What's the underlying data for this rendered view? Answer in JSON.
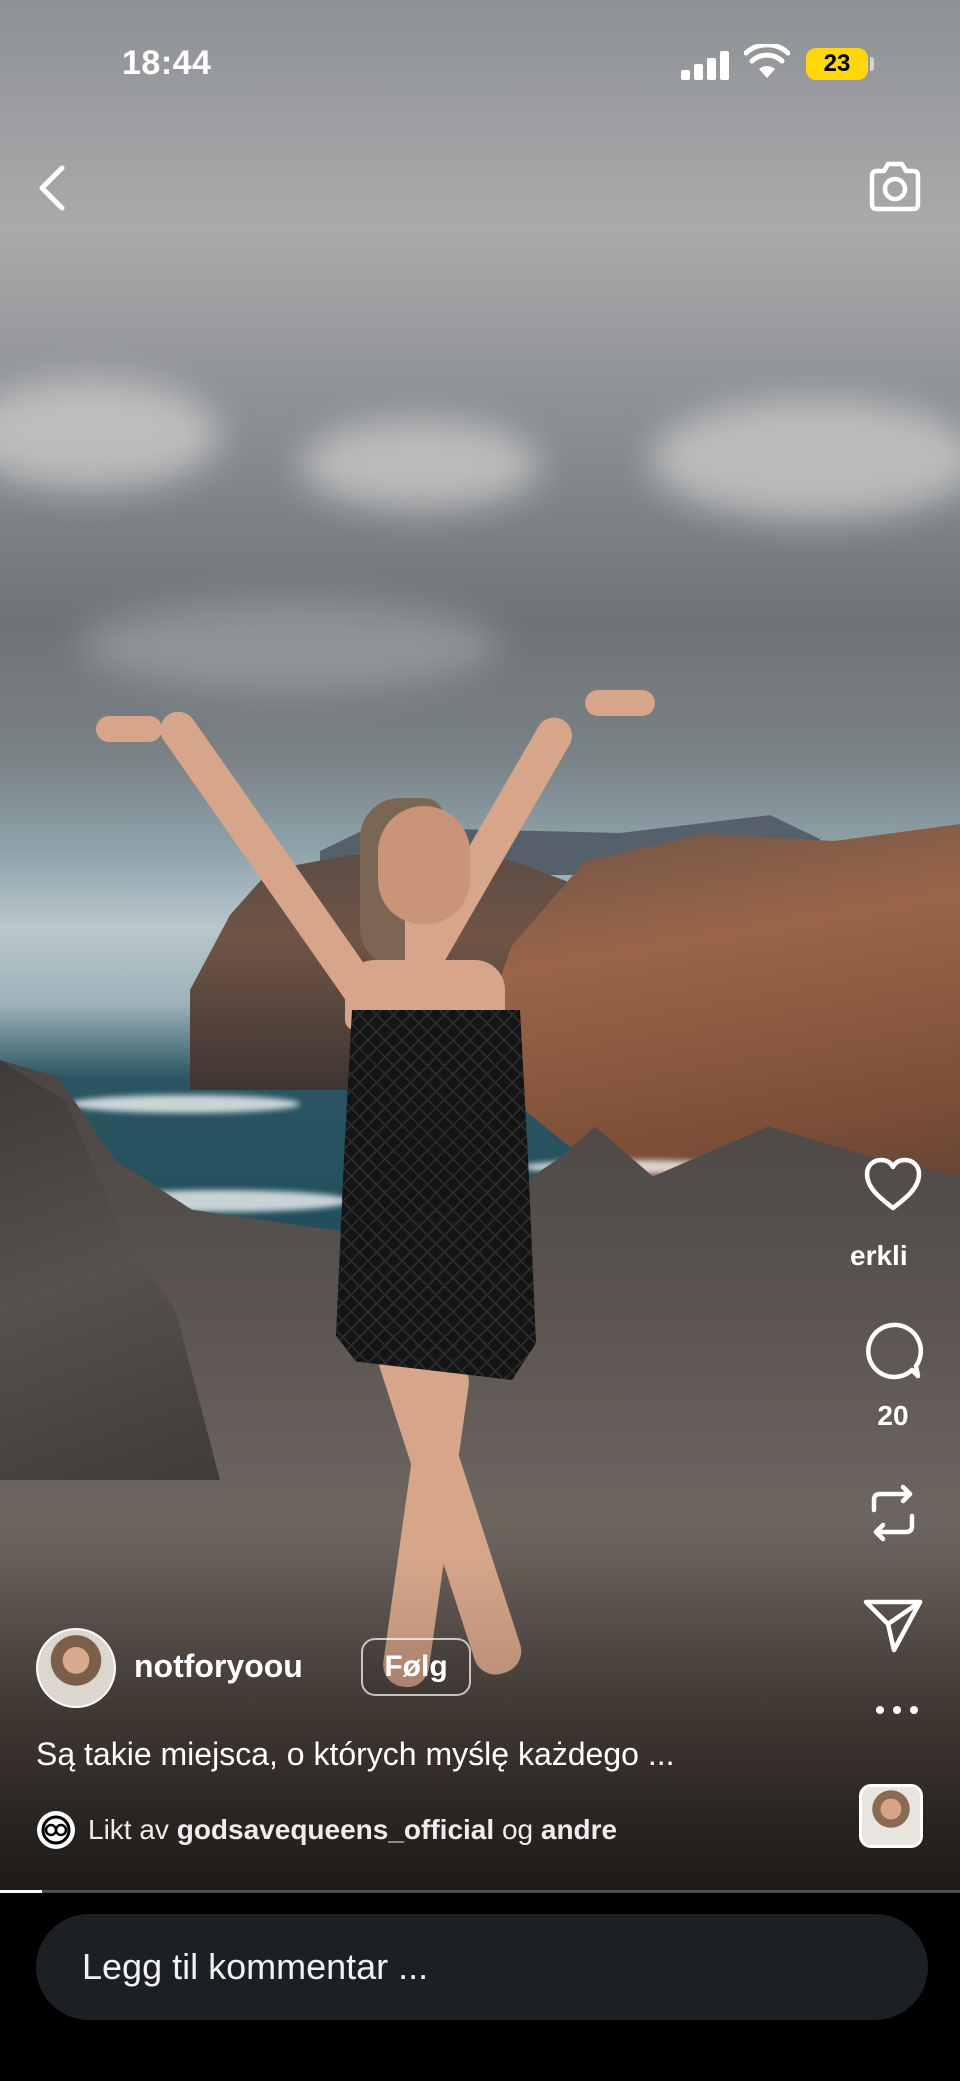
{
  "status_bar": {
    "time": "18:44",
    "battery": "23"
  },
  "nav": {
    "back_icon": "chevron-left-icon",
    "camera_icon": "camera-icon"
  },
  "rail": {
    "like_label": "erkli",
    "comment_count": "20",
    "icons": [
      "heart-icon",
      "comment-icon",
      "repost-icon",
      "send-icon",
      "more-icon"
    ]
  },
  "post": {
    "username": "notforyoou",
    "follow_label": "Følg",
    "caption": "Są takie miejsca, o których myślę każdego ...",
    "liked_prefix": "Likt av",
    "liked_user": "godsavequeens_official",
    "liked_joiner": "og",
    "liked_others": "andre"
  },
  "playback": {
    "progress": 0.044
  },
  "comment": {
    "placeholder": "Legg til kommentar ..."
  },
  "colors": {
    "battery": "#ffd60a",
    "comment_input_bg": "#1c2024",
    "bar_bg": "#000000"
  }
}
